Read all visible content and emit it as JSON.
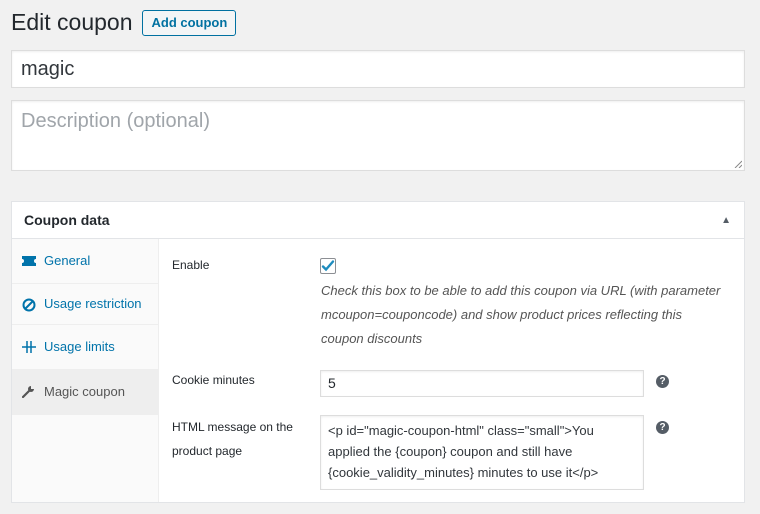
{
  "header": {
    "title": "Edit coupon",
    "add_label": "Add coupon"
  },
  "coupon_title": "magic",
  "description": {
    "placeholder": "Description (optional)"
  },
  "panel": {
    "title": "Coupon data",
    "toggle_icon": "triangle-up-icon"
  },
  "tabs": [
    {
      "label": "General",
      "icon": "ticket-icon",
      "active": false
    },
    {
      "label": "Usage restriction",
      "icon": "ban-icon",
      "active": false
    },
    {
      "label": "Usage limits",
      "icon": "limits-icon",
      "active": false
    },
    {
      "label": "Magic coupon",
      "icon": "wrench-icon",
      "active": true
    }
  ],
  "fields": {
    "enable": {
      "label": "Enable",
      "checked": true,
      "description": "Check this box to be able to add this coupon via URL (with parameter mcoupon=couponcode) and show product prices reflecting this coupon discounts"
    },
    "cookie": {
      "label": "Cookie minutes",
      "value": "5",
      "help": "?"
    },
    "html_message": {
      "label": "HTML message on the product page",
      "value": "<p id=\"magic-coupon-html\" class=\"small\">You applied the {coupon} coupon and still have {cookie_validity_minutes} minutes  to use it</p>",
      "help": "?"
    }
  },
  "colors": {
    "accent": "#0073aa",
    "checkmark": "#1e8cbe"
  }
}
